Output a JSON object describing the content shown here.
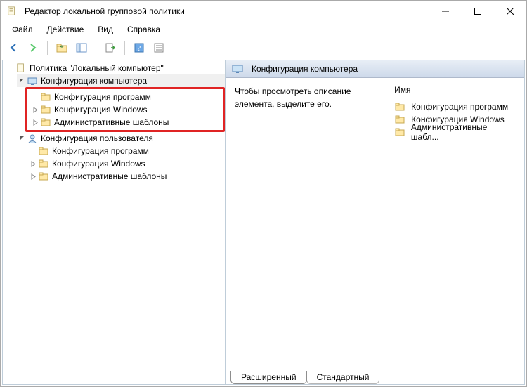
{
  "window": {
    "title": "Редактор локальной групповой политики"
  },
  "menu": {
    "file": "Файл",
    "action": "Действие",
    "view": "Вид",
    "help": "Справка"
  },
  "toolbar_icons": {
    "back": "back-arrow",
    "forward": "forward-arrow",
    "up": "up-folder",
    "show_hide": "show-hide-tree",
    "export": "export-list",
    "help": "help",
    "props": "properties"
  },
  "tree": {
    "root": "Политика \"Локальный компьютер\"",
    "computer": "Конфигурация компьютера",
    "computer_children": {
      "software": "Конфигурация программ",
      "windows": "Конфигурация Windows",
      "admin": "Административные шаблоны"
    },
    "user": "Конфигурация пользователя",
    "user_children": {
      "software": "Конфигурация программ",
      "windows": "Конфигурация Windows",
      "admin": "Административные шаблоны"
    }
  },
  "right": {
    "header": "Конфигурация компьютера",
    "description": "Чтобы просмотреть описание элемента, выделите его.",
    "name_col": "Имя",
    "items": {
      "software": "Конфигурация программ",
      "windows": "Конфигурация Windows",
      "admin": "Административные шабл..."
    }
  },
  "tabs": {
    "extended": "Расширенный",
    "standard": "Стандартный"
  }
}
